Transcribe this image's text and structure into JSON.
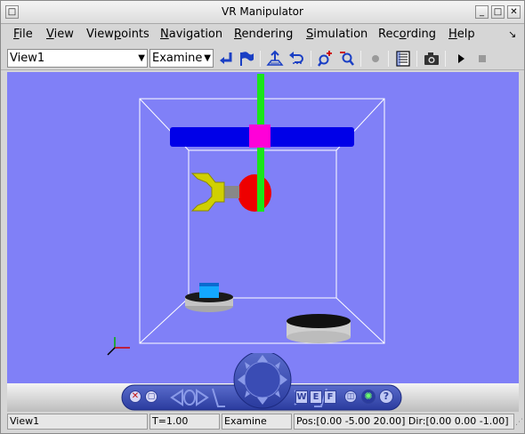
{
  "window": {
    "title": "VR Manipulator"
  },
  "menu": [
    {
      "label": "File",
      "u": "F",
      "rest": "ile"
    },
    {
      "label": "View",
      "u": "V",
      "rest": "iew"
    },
    {
      "label": "Viewpoints",
      "pre": "View",
      "u": "p",
      "rest": "oints"
    },
    {
      "label": "Navigation",
      "u": "N",
      "rest": "avigation"
    },
    {
      "label": "Rendering",
      "u": "R",
      "rest": "endering"
    },
    {
      "label": "Simulation",
      "u": "S",
      "rest": "imulation"
    },
    {
      "label": "Recording",
      "pre": "Rec",
      "u": "o",
      "rest": "rding"
    },
    {
      "label": "Help",
      "u": "H",
      "rest": "elp"
    }
  ],
  "toolbar": {
    "viewpoint_select": "View1",
    "navigation_select": "Examine"
  },
  "icons": {
    "accent": "#1a3fc4",
    "toolbar": [
      "go-to-viewpoint-icon",
      "create-viewpoint-icon",
      "straighten-up-icon",
      "undo-move-icon",
      "zoom-in-icon",
      "zoom-out-icon",
      "record-icon",
      "properties-icon",
      "screenshot-icon",
      "play-icon",
      "stop-icon"
    ]
  },
  "nav_panel": {
    "w": "W",
    "e": "E",
    "f": "F",
    "help": "?"
  },
  "status": {
    "viewpoint": "View1",
    "time": "T=1.00",
    "nav_mode": "Examine",
    "position": "Pos:[0.00 -5.00 20.00] Dir:[0.00 0.00 -1.00]"
  }
}
